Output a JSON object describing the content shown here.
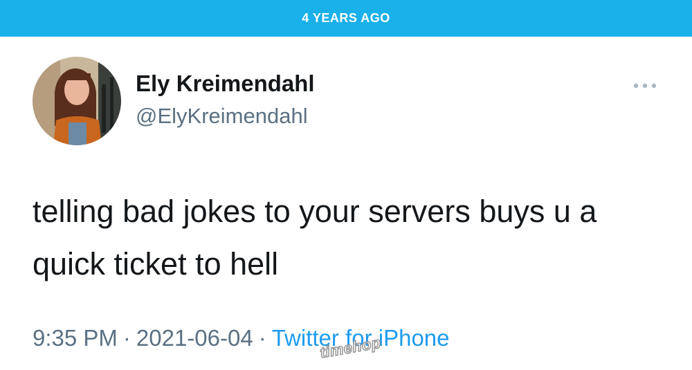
{
  "banner": {
    "text": "4 YEARS AGO"
  },
  "tweet": {
    "author": {
      "display_name": "Ely Kreimendahl",
      "handle": "@ElyKreimendahl"
    },
    "more_label": "•••",
    "text": "telling bad jokes to your servers buys u a quick ticket to hell",
    "time": "9:35 PM",
    "separator": "·",
    "date": "2021-06-04",
    "source": "Twitter for iPhone"
  },
  "watermark": {
    "text": "timehop"
  },
  "colors": {
    "banner": "#1ab0e9",
    "name_text": "#14171a",
    "secondary_text": "#5b7083",
    "link": "#1d9bf0"
  }
}
